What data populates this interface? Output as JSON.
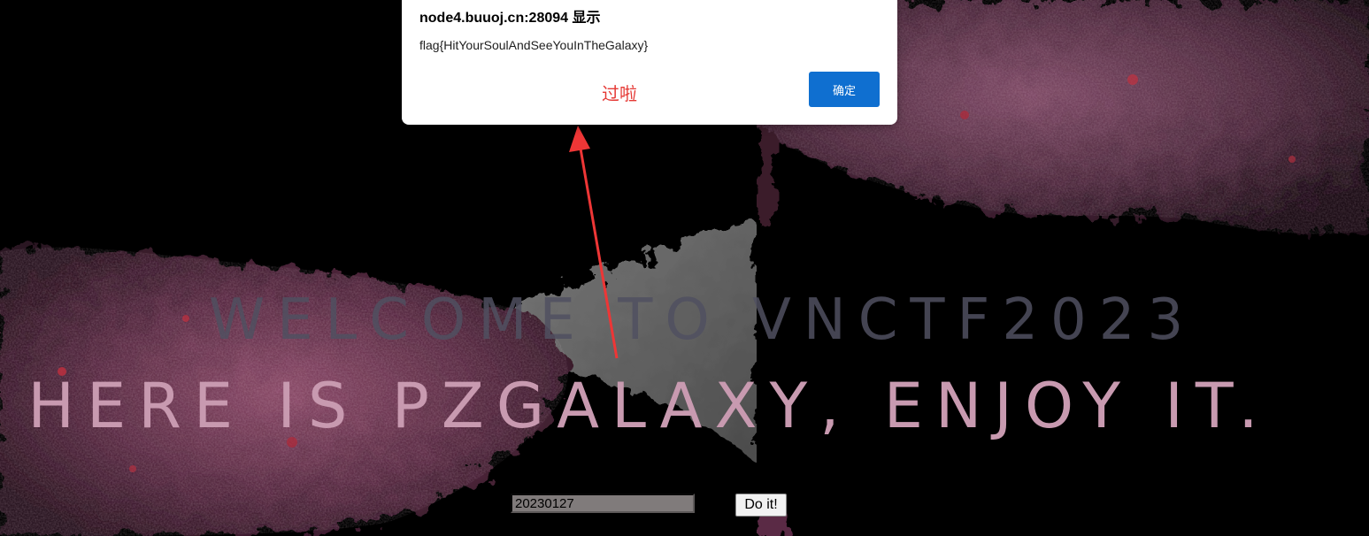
{
  "dialog": {
    "title": "node4.buuoj.cn:28094 显示",
    "message": "flag{HitYourSoulAndSeeYouInTheGalaxy}",
    "ok_label": "确定"
  },
  "annotation": {
    "text": "过啦",
    "color": "#e53935"
  },
  "page": {
    "heading_line1": "WELCOME TO VNCTF2023",
    "heading_line2": "HERE IS PZGALAXY, ENJOY IT."
  },
  "form": {
    "date_value": "20230127",
    "submit_label": "Do it!"
  },
  "colors": {
    "background": "#000000",
    "dialog_button": "#0f6fd0",
    "heading_line1": "#50505f",
    "heading_line2": "#c89ab0",
    "input_background": "#807b7b"
  }
}
